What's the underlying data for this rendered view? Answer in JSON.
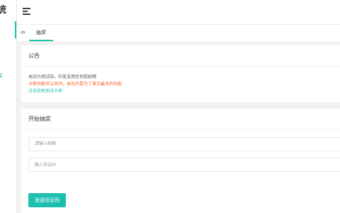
{
  "sidebar": {
    "brand": "统",
    "nav_item": "奖"
  },
  "header": {
    "menu_icon": "menu-icon"
  },
  "tabs": {
    "handle": "⇔",
    "active": "抽奖"
  },
  "notice": {
    "title": "公告",
    "line1": "本站为测试站，中奖没用任何奖励哦",
    "line2": "卡密功能可以关闭，本站只是为了显示最多的功能",
    "line3": "点击获取测试卡密"
  },
  "lottery": {
    "title": "开始抽奖",
    "email_placeholder": "请输入邮箱",
    "code_placeholder": "输入验证码",
    "send_button": "发送验证码"
  },
  "colors": {
    "accent": "#1ebfae",
    "warn": "#ff5722"
  }
}
